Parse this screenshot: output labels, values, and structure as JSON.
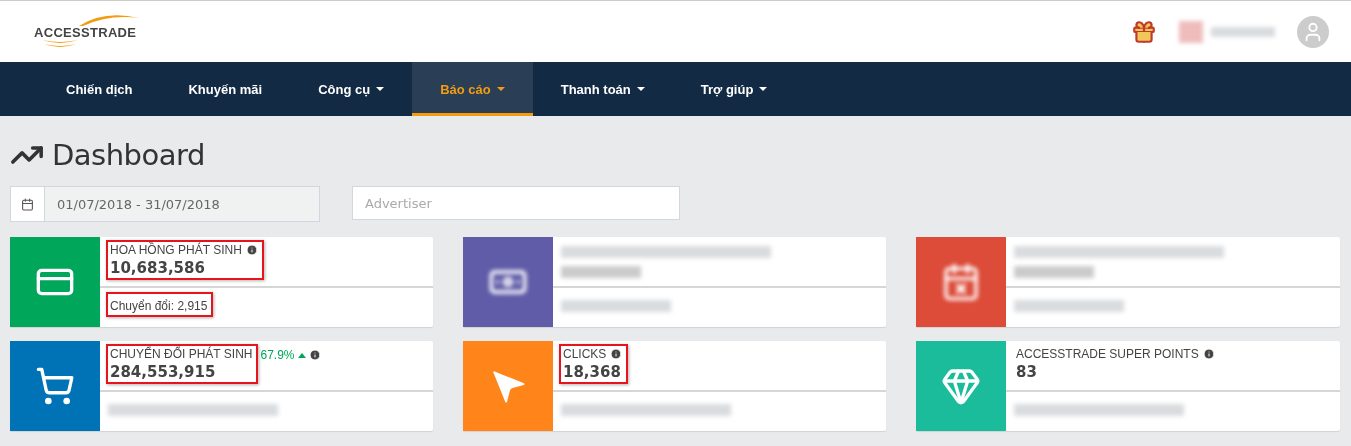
{
  "header": {
    "logo": "ACCESSTRADE",
    "user_redacted": true
  },
  "nav": [
    {
      "label": "Chiến dịch",
      "dropdown": false,
      "selected": false
    },
    {
      "label": "Khuyến mãi",
      "dropdown": false,
      "selected": false
    },
    {
      "label": "Công cụ",
      "dropdown": true,
      "selected": false
    },
    {
      "label": "Báo cáo",
      "dropdown": true,
      "selected": true
    },
    {
      "label": "Thanh toán",
      "dropdown": true,
      "selected": false
    },
    {
      "label": "Trợ giúp",
      "dropdown": true,
      "selected": false
    }
  ],
  "page_title": "Dashboard",
  "filters": {
    "date_range": "01/07/2018 - 31/07/2018",
    "advertiser": {
      "placeholder": "Advertiser"
    }
  },
  "cards": [
    {
      "kind": "stat",
      "color": "#00a65a",
      "title": "HOA HỒNG PHÁT SINH",
      "value": "10,683,586",
      "footer": "Chuyển đổi: 2,915",
      "highlight_head": true,
      "highlight_foot": true
    },
    {
      "kind": "redacted",
      "color": "#605ca8"
    },
    {
      "kind": "redacted",
      "color": "#dd4b39"
    },
    {
      "kind": "stat",
      "color": "#0073b7",
      "title": "CHUYỂN ĐỔI PHÁT SINH",
      "value": "284,553,915",
      "trend": "67.9%",
      "trend_up": true,
      "footer_redacted": true,
      "highlight_head": true
    },
    {
      "kind": "stat",
      "color": "#ff851b",
      "title": "CLICKS",
      "value": "18,368",
      "footer_redacted": true,
      "highlight_head": true
    },
    {
      "kind": "stat",
      "color": "#1abc9c",
      "title": "ACCESSTRADE SUPER POINTS",
      "value": "83",
      "footer_redacted": true
    }
  ]
}
